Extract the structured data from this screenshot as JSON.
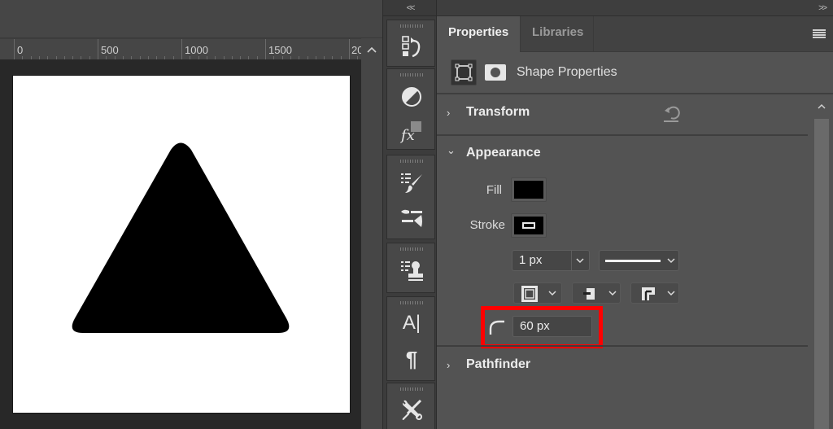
{
  "document": {
    "ruler": {
      "labels": [
        "0",
        "500",
        "1000",
        "1500",
        "20"
      ],
      "scroll_up_glyph": "^"
    },
    "artboard": {
      "background": "#ffffff",
      "shape": "rounded-triangle",
      "shape_fill": "#000000"
    }
  },
  "toolbar": {
    "collapse_glyph": "<<",
    "tools": [
      {
        "name": "history-icon"
      },
      {
        "name": "adjustments-icon"
      },
      {
        "name": "styles-fx-icon"
      },
      {
        "name": "brush-presets-icon"
      },
      {
        "name": "brush-settings-icon"
      },
      {
        "name": "clone-source-icon"
      },
      {
        "name": "character-icon",
        "glyph": "A|"
      },
      {
        "name": "paragraph-icon",
        "glyph": "¶"
      },
      {
        "name": "tool-presets-icon"
      }
    ]
  },
  "panel": {
    "collapse_glyph": ">>",
    "tabs": [
      {
        "label": "Properties",
        "active": true
      },
      {
        "label": "Libraries",
        "active": false
      }
    ],
    "shape_properties_label": "Shape Properties",
    "sections": {
      "transform": {
        "title": "Transform",
        "expanded": false,
        "chevron": "›"
      },
      "appearance": {
        "title": "Appearance",
        "expanded": true,
        "chevron": "⌄"
      },
      "pathfinder": {
        "title": "Pathfinder",
        "expanded": false,
        "chevron": "›"
      }
    },
    "appearance": {
      "fill_label": "Fill",
      "fill_color": "#000000",
      "stroke_label": "Stroke",
      "stroke_color": "#000000",
      "stroke_width": "1 px",
      "stroke_style": "solid",
      "corner_radius": "60 px",
      "highlight_color": "#ff0000"
    }
  }
}
